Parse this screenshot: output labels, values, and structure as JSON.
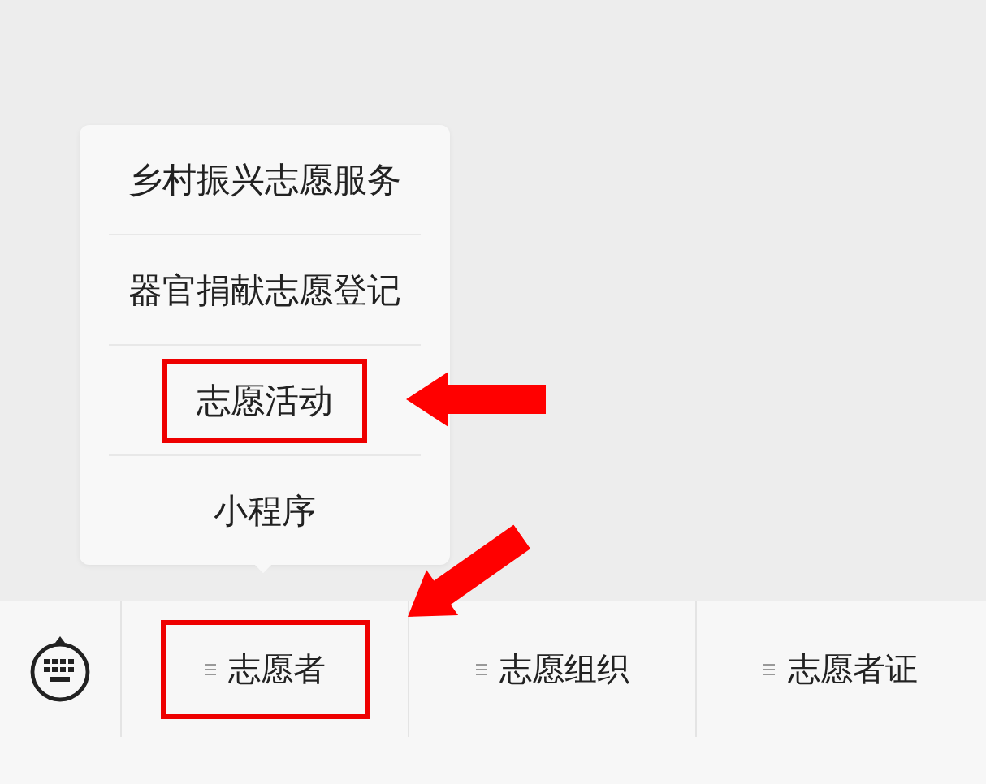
{
  "menu_bar": {
    "items": [
      {
        "label": "志愿者",
        "expanded": true,
        "annotated": true,
        "children": [
          {
            "label": "乡村振兴志愿服务",
            "annotated": false
          },
          {
            "label": "器官捐献志愿登记",
            "annotated": false
          },
          {
            "label": "志愿活动",
            "annotated": true
          },
          {
            "label": "小程序",
            "annotated": false
          }
        ]
      },
      {
        "label": "志愿组织",
        "expanded": false,
        "annotated": false
      },
      {
        "label": "志愿者证",
        "expanded": false,
        "annotated": false
      }
    ]
  }
}
